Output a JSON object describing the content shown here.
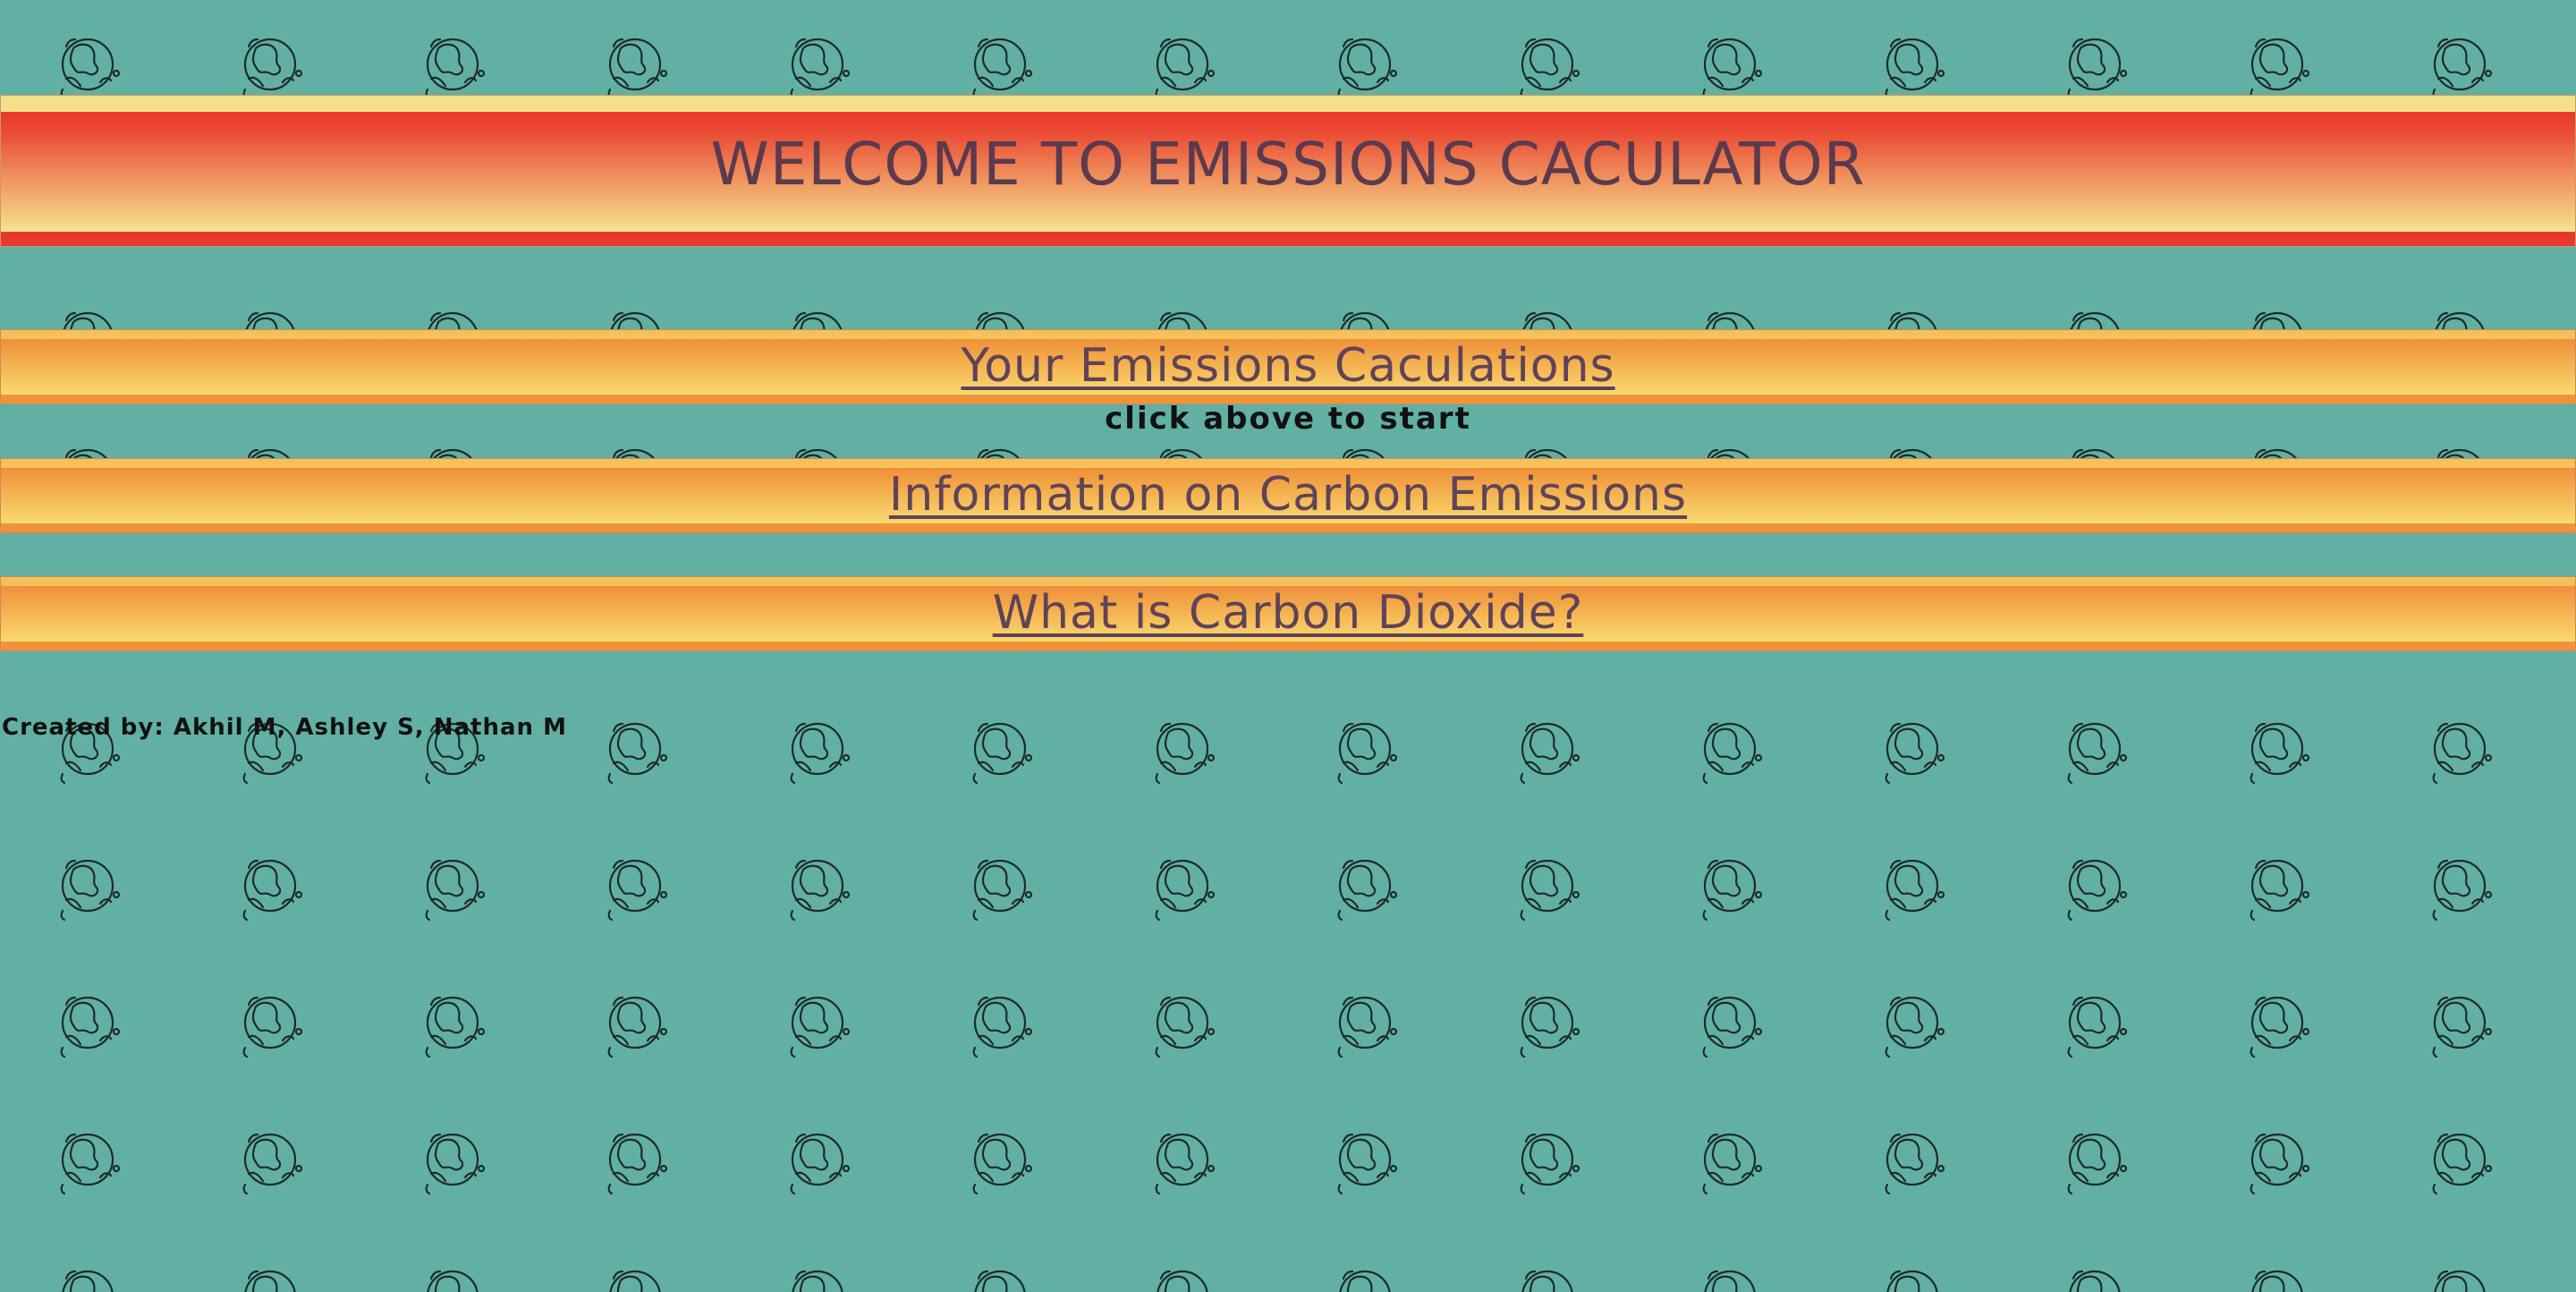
{
  "page": {
    "background_color": "#62b0a3",
    "background_icon": "earth-globe-outline-icon"
  },
  "header": {
    "title": "WELCOME TO EMISSIONS CACULATOR"
  },
  "nav": {
    "calculations_link": "Your Emissions Caculations",
    "start_hint": "click above to start",
    "info_link": "Information on Carbon Emissions",
    "co2_link": "What is Carbon Dioxide?"
  },
  "footer": {
    "credits": "Created by: Akhil M, Ashley S, Nathan M"
  },
  "colors": {
    "header_red": "#e9382c",
    "header_yellow": "#f3e48f",
    "nav_orange": "#ef8f3a",
    "nav_yellow": "#f9d56d",
    "link_text": "#5f4358",
    "title_text": "#5b3a4e"
  }
}
